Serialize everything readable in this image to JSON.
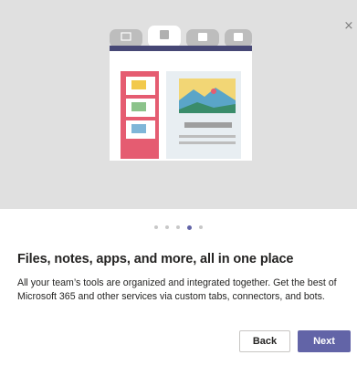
{
  "dialog": {
    "close_glyph": "×",
    "carousel": {
      "total_slides": 5,
      "active_index": 3
    },
    "title": "Files, notes, apps, and more, all in one place",
    "description": "All your team’s tools are organized and integrated together. Get the best of Microsoft 365 and other services via custom tabs, connectors, and bots.",
    "buttons": {
      "back_label": "Back",
      "next_label": "Next"
    }
  },
  "illustration": {
    "tab_icons": [
      "chat-icon",
      "word-document-icon",
      "powerpoint-icon",
      "excel-icon"
    ],
    "colors": {
      "accent": "#6264a7",
      "tab_bar": "#464775",
      "sidebar": "#e55c71",
      "hero_background": "#e0e0e0"
    }
  }
}
